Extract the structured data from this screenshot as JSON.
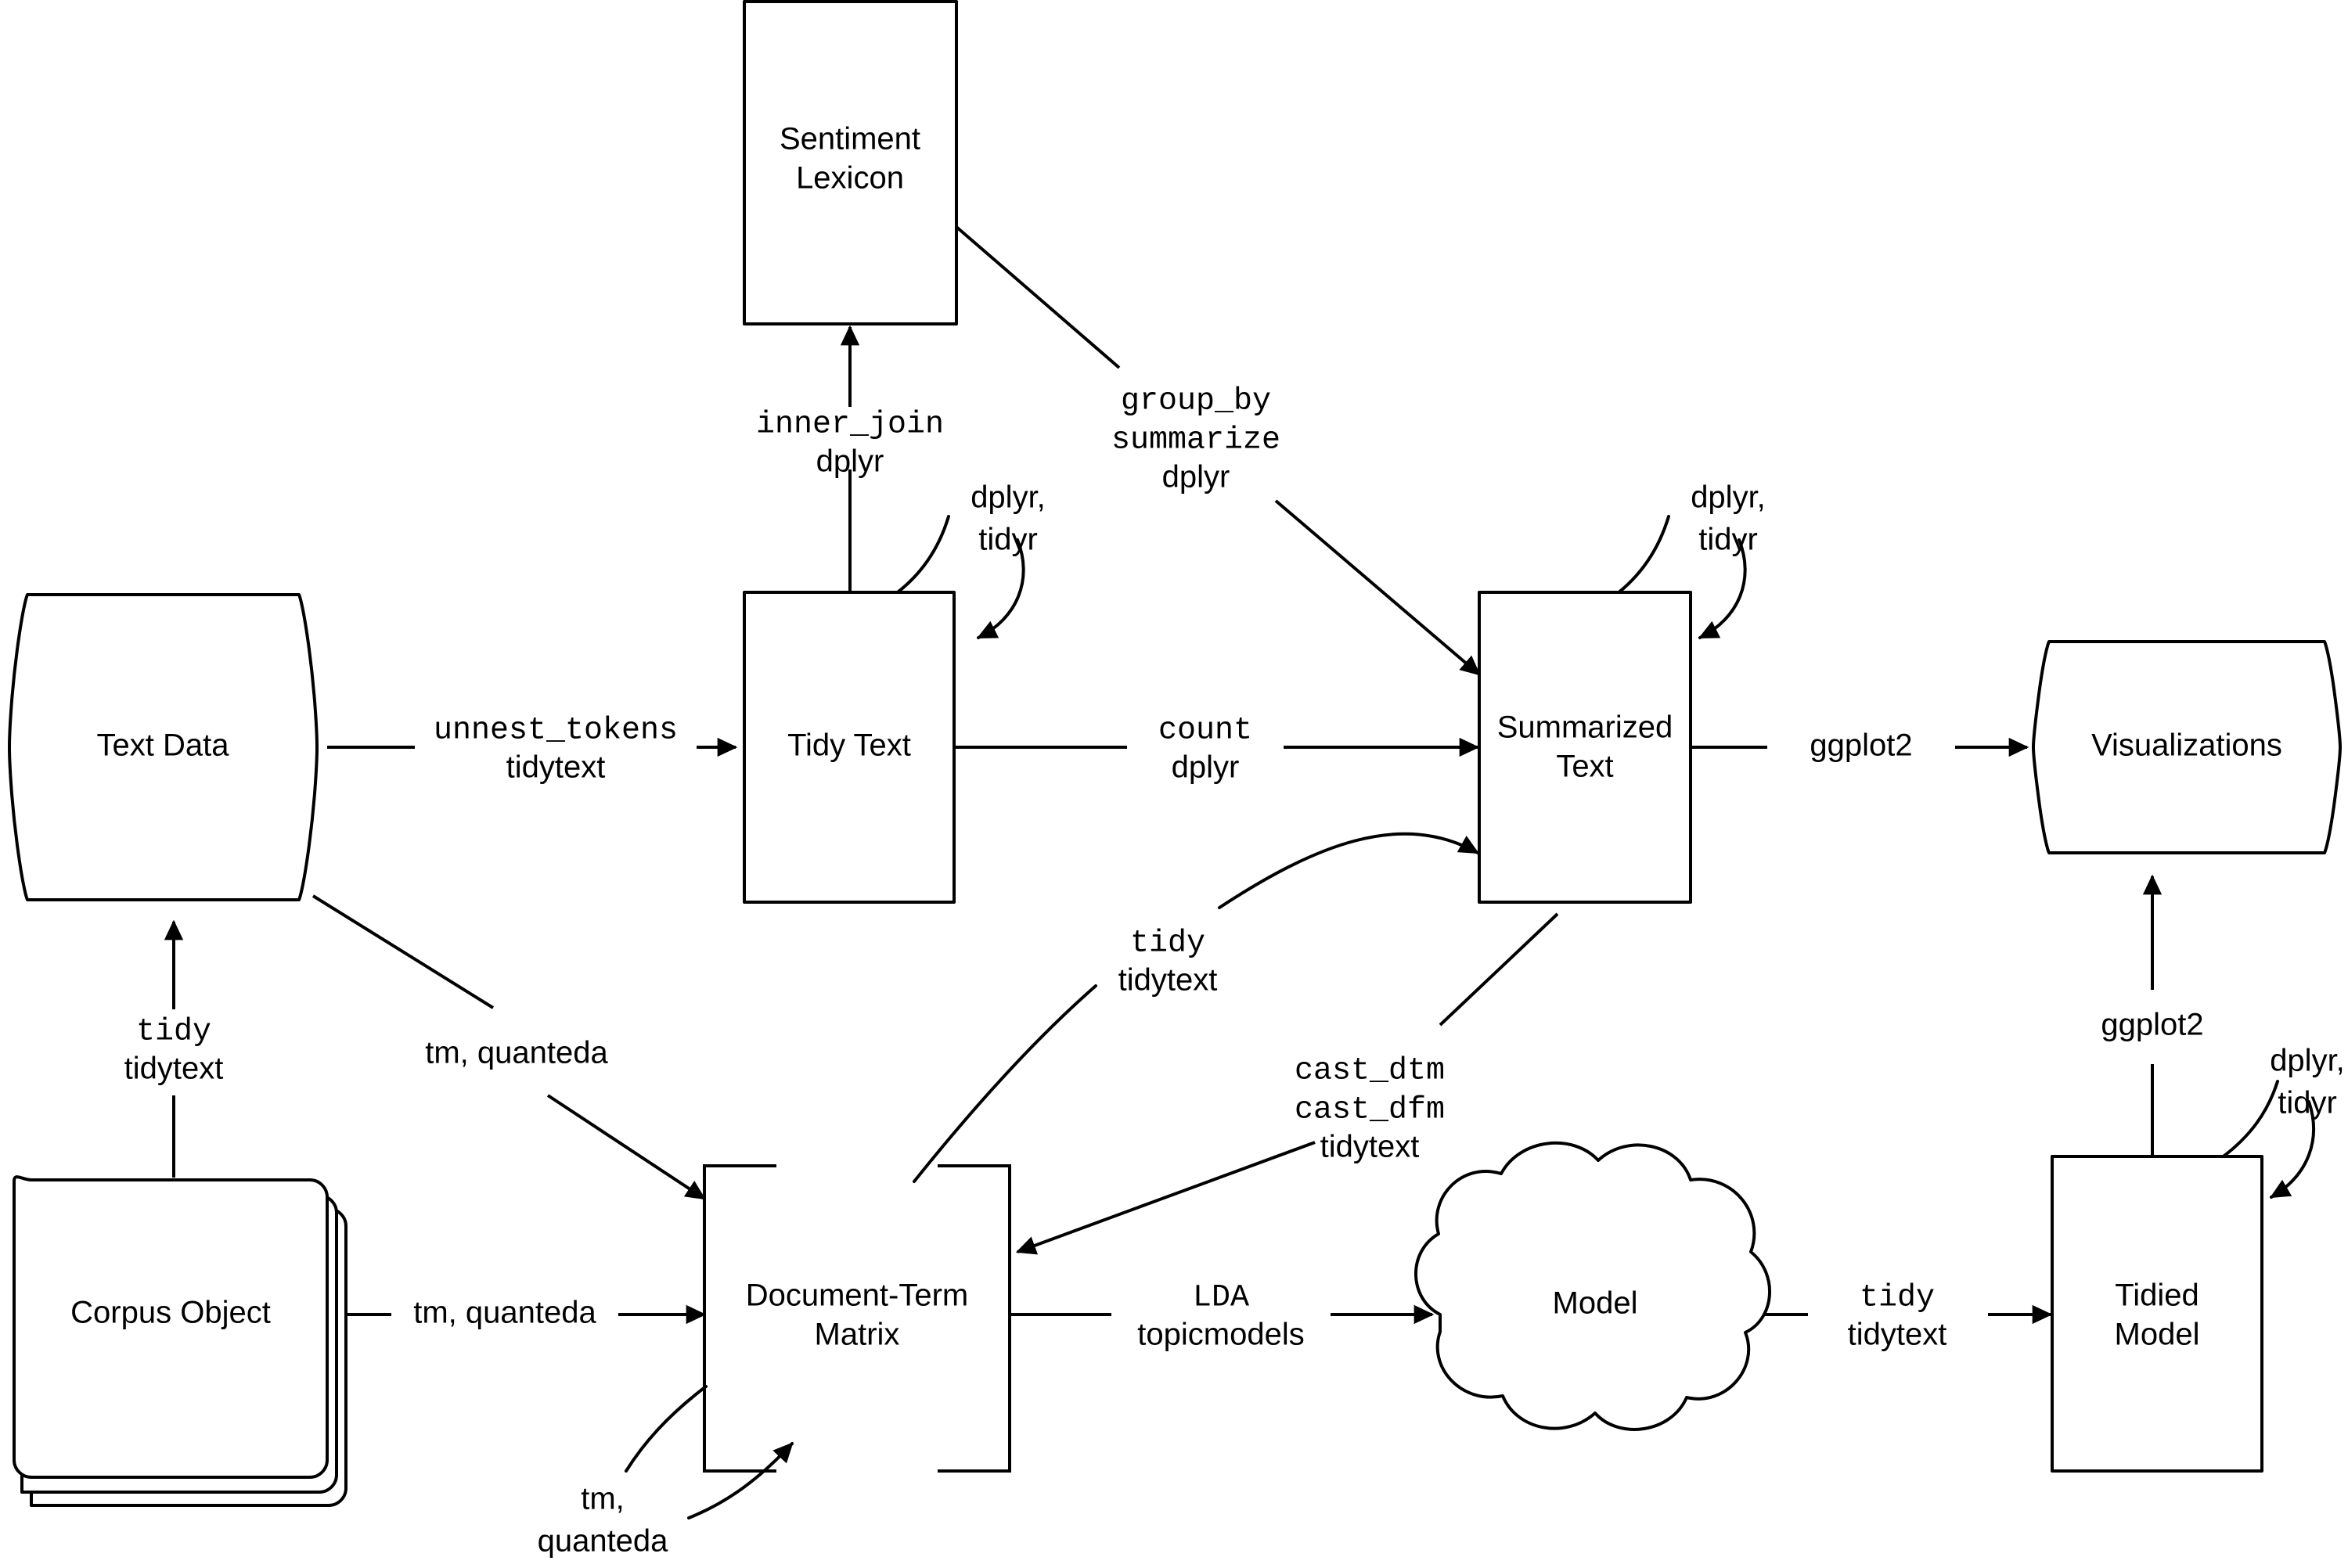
{
  "diagram": {
    "title": "Tidy Text Mining Workflow",
    "background_color": "#ffffff",
    "stroke_color": "#000000"
  },
  "nodes": {
    "sentiment_lexicon": {
      "label_line1": "Sentiment",
      "label_line2": "Lexicon",
      "shape": "rectangle"
    },
    "text_data": {
      "label": "Text Data",
      "shape": "cylinder"
    },
    "tidy_text": {
      "label": "Tidy Text",
      "shape": "rectangle"
    },
    "summarized_text": {
      "label_line1": "Summarized",
      "label_line2": "Text",
      "shape": "rectangle"
    },
    "visualizations": {
      "label": "Visualizations",
      "shape": "cylinder"
    },
    "corpus_object": {
      "label": "Corpus Object",
      "shape": "stacked-document"
    },
    "document_term_matrix": {
      "label_line1": "Document-Term",
      "label_line2": "Matrix",
      "shape": "matrix-brackets"
    },
    "model": {
      "label": "Model",
      "shape": "cloud"
    },
    "tidied_model": {
      "label_line1": "Tidied",
      "label_line2": "Model",
      "shape": "rectangle"
    }
  },
  "edges": {
    "text_data_to_tidy_text": {
      "function": "unnest_tokens",
      "package": "tidytext"
    },
    "tidy_text_to_sentiment_lexicon": {
      "function": "inner_join",
      "package": "dplyr"
    },
    "tidy_text_self_loop": {
      "packages": "dplyr,\ntidyr",
      "line1": "dplyr,",
      "line2": "tidyr"
    },
    "sentiment_lexicon_to_summarized_text": {
      "function_line1": "group_by",
      "function_line2": "summarize",
      "package": "dplyr"
    },
    "tidy_text_to_summarized_text": {
      "function": "count",
      "package": "dplyr"
    },
    "summarized_text_self_loop": {
      "line1": "dplyr,",
      "line2": "tidyr"
    },
    "summarized_text_to_visualizations": {
      "package": "ggplot2"
    },
    "corpus_object_to_text_data": {
      "function": "tidy",
      "package": "tidytext"
    },
    "text_data_to_dtm": {
      "packages": "tm, quanteda"
    },
    "corpus_object_to_dtm": {
      "packages": "tm, quanteda"
    },
    "dtm_self_loop": {
      "line1": "tm,",
      "line2": "quanteda"
    },
    "dtm_to_summarized_text": {
      "function": "tidy",
      "package": "tidytext"
    },
    "summarized_text_to_dtm": {
      "function_line1": "cast_dtm",
      "function_line2": "cast_dfm",
      "package": "tidytext"
    },
    "dtm_to_model": {
      "function": "LDA",
      "package": "topicmodels"
    },
    "model_to_tidied_model": {
      "function": "tidy",
      "package": "tidytext"
    },
    "tidied_model_to_visualizations": {
      "package": "ggplot2"
    },
    "tidied_model_self_loop": {
      "line1": "dplyr,",
      "line2": "tidyr"
    }
  }
}
